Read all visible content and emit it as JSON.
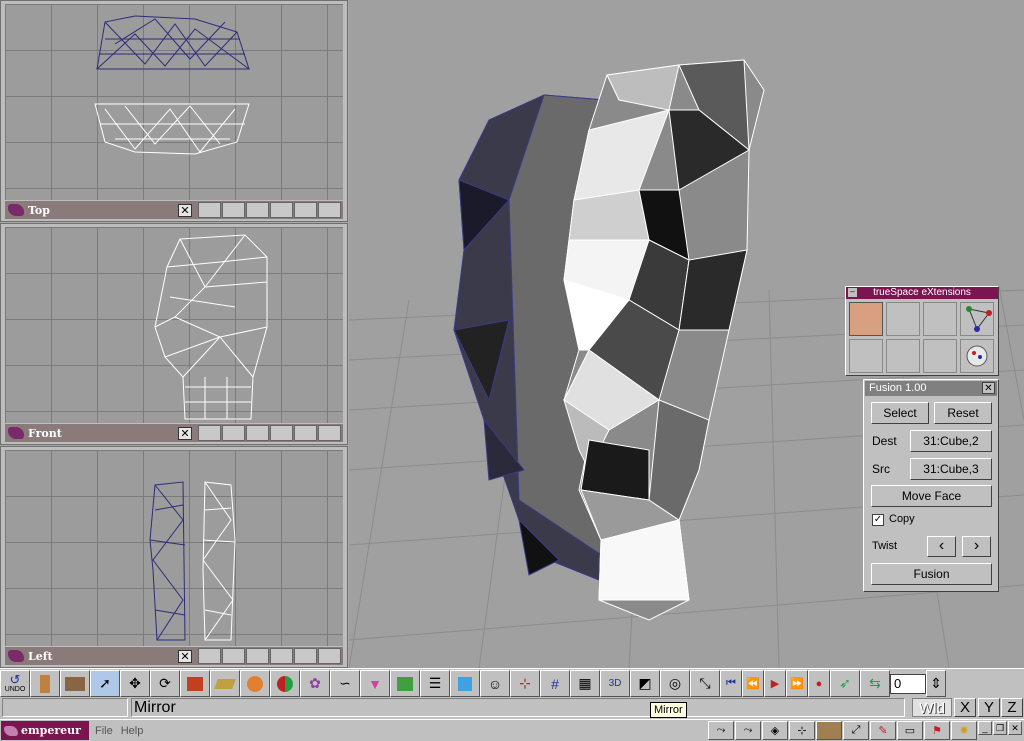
{
  "viewports": [
    {
      "title": "Top"
    },
    {
      "title": "Front"
    },
    {
      "title": "Left"
    }
  ],
  "close_glyph": "✕",
  "extensions": {
    "title": "trueSpace eXtensions"
  },
  "fusion": {
    "title": "Fusion 1.00",
    "select_label": "Select",
    "reset_label": "Reset",
    "dest_label": "Dest",
    "dest_value": "31:Cube,2",
    "src_label": "Src",
    "src_value": "31:Cube,3",
    "move_face_label": "Move Face",
    "copy_label": "Copy",
    "copy_checked": "✓",
    "twist_label": "Twist",
    "twist_left": "‹",
    "twist_right": "›",
    "fusion_label": "Fusion"
  },
  "toolbar": {
    "undo_label": "UNDO",
    "frame_value": "0",
    "tooltip": "Mirror"
  },
  "status": {
    "text": "Mirror",
    "coord_mode": "Wld",
    "x": "X",
    "y": "Y",
    "z": "Z"
  },
  "taskbar": {
    "app_name": "empereur",
    "menu_file": "File",
    "menu_help": "Help"
  },
  "colors": {
    "background": "#a0a0a0",
    "panel": "#c0c0c0",
    "title_magenta": "#7a1550",
    "wire_blue": "#3a3a8a"
  }
}
